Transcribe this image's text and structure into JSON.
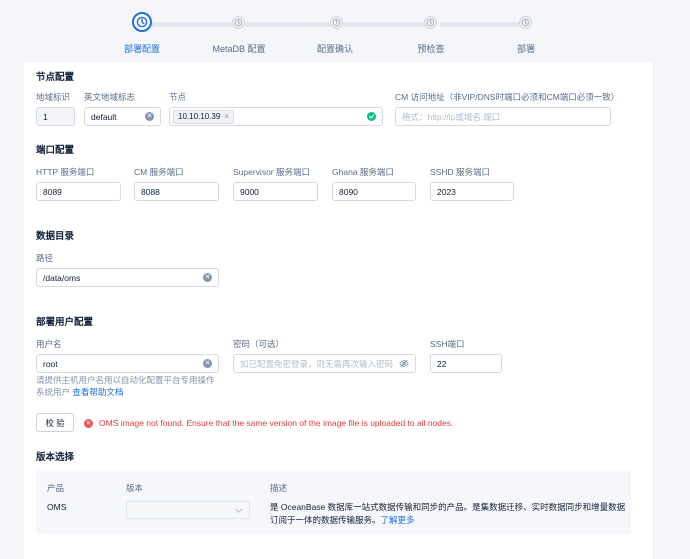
{
  "steps": [
    {
      "label": "部署配置",
      "active": true
    },
    {
      "label": "MetaDB 配置",
      "active": false
    },
    {
      "label": "配置确认",
      "active": false
    },
    {
      "label": "预检查",
      "active": false
    },
    {
      "label": "部署",
      "active": false
    }
  ],
  "node_config": {
    "title": "节点配置",
    "region_id_label": "地域标识",
    "region_id_value": "1",
    "region_en_label": "英文地域标志",
    "region_en_value": "default",
    "node_label": "节点",
    "node_tag": "10.10.10.39",
    "cm_address_label": "CM 访问地址（非VIP/DNS时端口必须和CM端口必须一致）",
    "cm_address_placeholder": "格式：http://ip或域名:端口"
  },
  "port_config": {
    "title": "端口配置",
    "http_label": "HTTP 服务端口",
    "http_value": "8089",
    "cm_label": "CM 服务端口",
    "cm_value": "8088",
    "supervisor_label": "Supervisor 服务端口",
    "supervisor_value": "9000",
    "ghana_label": "Ghana 服务端口",
    "ghana_value": "8090",
    "sshd_label": "SSHD 服务端口",
    "sshd_value": "2023"
  },
  "data_dir": {
    "title": "数据目录",
    "path_label": "路径",
    "path_value": "/data/oms"
  },
  "user_config": {
    "title": "部署用户配置",
    "username_label": "用户名",
    "username_value": "root",
    "password_label": "密码（可选）",
    "password_placeholder": "如已配置免密登录，则无需再次输入密码",
    "ssh_port_label": "SSH端口",
    "ssh_port_value": "22",
    "helper_line1": "请提供主机用户名用以自动化配置平台专用操作",
    "helper_line2": "系统用户",
    "helper_link": "查看帮助文档"
  },
  "verify": {
    "button_label": "校 验",
    "error_message": "OMS image not found. Ensure that the same version of the image file is uploaded to all nodes."
  },
  "version": {
    "title": "版本选择",
    "col_product": "产品",
    "col_version": "版本",
    "col_desc": "描述",
    "product": "OMS",
    "desc_line1": "是 OceanBase 数据库一站式数据传输和同步的产品。是集数据迁移、实时数据同步和增量数据",
    "desc_line2": "订阅于一体的数据传输服务。",
    "desc_link": "了解更多"
  },
  "colors": {
    "primary": "#1f6fe0",
    "success": "#0ac185",
    "error": "#e43c3c"
  }
}
